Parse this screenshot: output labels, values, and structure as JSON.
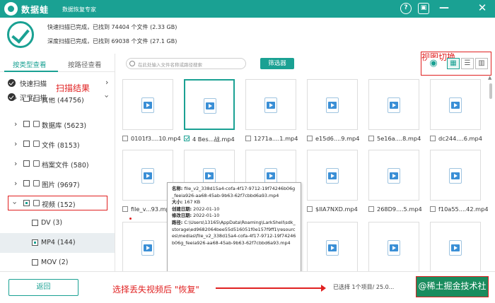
{
  "titlebar": {
    "app_name": "数据蛙",
    "subtitle": "数据恢复专家",
    "bg": "#1aa193"
  },
  "summary": {
    "quick_scan": "快速扫描已完成，已找到 74404 个文件 (2.33 GB)",
    "deep_scan": "深度扫描已完成，已找到 69038 个文件 (27.1 GB)"
  },
  "annotations": {
    "view_switch": "视图切换",
    "scan_result": "扫描结果",
    "restore_note": "选择丢失视频后 \"恢复\""
  },
  "sidebar": {
    "tabs": [
      "按类型查看",
      "按路径查看"
    ],
    "quick_scan": "快速扫描",
    "deep_scan": "深度扫描",
    "items": [
      {
        "label": "其他 (44756)"
      },
      {
        "label": "数据库 (5623)"
      },
      {
        "label": "文件 (8153)"
      },
      {
        "label": "档案文件 (580)"
      },
      {
        "label": "图片 (9697)"
      },
      {
        "label": "视频 (152)"
      }
    ],
    "sub_items": [
      {
        "label": "DV (3)"
      },
      {
        "label": "MP4 (144)"
      },
      {
        "label": "MOV (2)"
      }
    ]
  },
  "toolbar": {
    "search_placeholder": "在此处输入文件名称或路径搜索",
    "filter_label": "筛选器"
  },
  "files": [
    {
      "name": "0101f3....10.mp4",
      "checked": false
    },
    {
      "name": "4 Bes...战.mp4",
      "checked": true
    },
    {
      "name": "1271a....1.mp4",
      "checked": false
    },
    {
      "name": "e15d6....9.mp4",
      "checked": false
    },
    {
      "name": "5e16a....8.mp4",
      "checked": false
    },
    {
      "name": "dc244....6.mp4",
      "checked": false
    },
    {
      "name": "file_v...93.mp4",
      "checked": false
    },
    {
      "name": "",
      "checked": false
    },
    {
      "name": "",
      "checked": false
    },
    {
      "name": "$IIA7NXD.mp4",
      "checked": false
    },
    {
      "name": "268D9....5.mp4",
      "checked": false
    },
    {
      "name": "f10a55....42.mp4",
      "checked": false
    }
  ],
  "tooltip": {
    "name_key": "名称:",
    "name_val": "file_v2_338d15a4-cofa-4f17-9712-19f74246b06g_feeia926-aa68-45ab-9b63-62f7cbbd6a93.mp4",
    "size_key": "大小:",
    "size_val": "167 KB",
    "created_key": "创建日期:",
    "created_val": "2022-01-10",
    "modified_key": "修改日期:",
    "modified_val": "2022-01-10",
    "path_key": "路径:",
    "path_val": "C:\\Users\\13165\\AppData\\Roaming\\LarkShell\\sdk_storage\\ed9682064bee55d516051f0e157f9ff1\\resources\\medias\\file_v2_338d15a4-cofa-4f17-9712-19f74246b06g_feeia926-aa68-45ab-9b63-62f7cbbd6a93.mp4"
  },
  "footer": {
    "back_label": "返回",
    "selected": "已选择 1个项目/ 25.0...",
    "restore_label": "@稀土掘金技术社区"
  }
}
